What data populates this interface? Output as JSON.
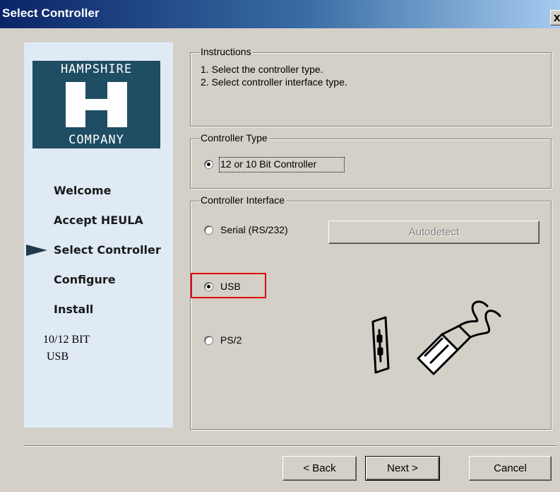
{
  "window": {
    "title": "Select Controller",
    "close_glyph": "x"
  },
  "logo": {
    "top_text": "HAMPSHIRE",
    "bottom_text": "COMPANY",
    "brand_color": "#1f4d63"
  },
  "steps": [
    {
      "label": "Welcome",
      "current": false
    },
    {
      "label": "Accept HEULA",
      "current": false
    },
    {
      "label": "Select Controller",
      "current": true
    },
    {
      "label": "Configure",
      "current": false
    },
    {
      "label": "Install",
      "current": false
    }
  ],
  "side_info": {
    "line1": "10/12 BIT",
    "line2": "USB"
  },
  "instructions": {
    "legend": "Instructions",
    "line1": "1. Select the controller type.",
    "line2": "2. Select controller interface type."
  },
  "controller_type": {
    "legend": "Controller Type",
    "option": {
      "label": "12 or 10 Bit Controller",
      "selected": true
    }
  },
  "controller_interface": {
    "legend": "Controller Interface",
    "options": [
      {
        "label": "Serial (RS/232)",
        "selected": false
      },
      {
        "label": "USB",
        "selected": true
      },
      {
        "label": "PS/2",
        "selected": false
      }
    ],
    "autodetect_label": "Autodetect",
    "autodetect_enabled": false
  },
  "buttons": {
    "back": "< Back",
    "next": "Next >",
    "cancel": "Cancel"
  },
  "highlight_color": "#e00000"
}
